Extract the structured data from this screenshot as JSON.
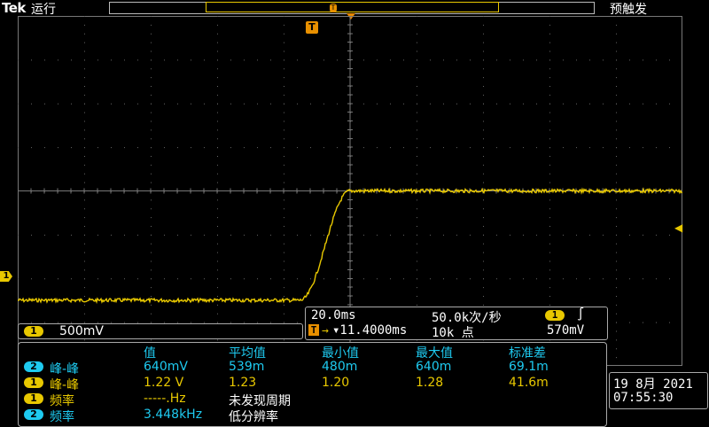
{
  "header": {
    "brand": "Tek",
    "run_status": "运行",
    "trigger_status": "预触发"
  },
  "markers": {
    "trigger_t": "T",
    "ch1_marker": "1",
    "trigger_level_arrow": "◀"
  },
  "channel_scale": {
    "channel": "1",
    "scale": "500mV"
  },
  "timebase": {
    "time_per_div": "20.0ms",
    "sample_rate": "50.0k次/秒",
    "trigger_channel": "1",
    "trigger_slope": "∫",
    "trigger_level": "570mV",
    "trigger_delay_label": "T",
    "trigger_delay": "▾11.4000ms",
    "record_length": "10k 点"
  },
  "measurements": {
    "headers": [
      "值",
      "平均值",
      "最小值",
      "最大值",
      "标准差"
    ],
    "rows": [
      {
        "channel": "2",
        "name": "峰-峰",
        "value": "640mV",
        "mean": "539m",
        "min": "480m",
        "max": "640m",
        "std": "69.1m"
      },
      {
        "channel": "1",
        "name": "峰-峰",
        "value": "1.22 V",
        "mean": "1.23",
        "min": "1.20",
        "max": "1.28",
        "std": "41.6m"
      },
      {
        "channel": "1",
        "name": "频率",
        "value": "-----.Hz",
        "note": "未发现周期"
      },
      {
        "channel": "2",
        "name": "频率",
        "value": "3.448kHz",
        "note": "低分辨率"
      }
    ]
  },
  "datetime": {
    "date": "19 8月  2021",
    "time": "07:55:30"
  },
  "colors": {
    "ch1": "#e8c800",
    "ch2": "#1ecaf0",
    "trigger": "#e89000"
  },
  "waveform": {
    "channel": "1",
    "low_level_div": 2.5,
    "high_level_div": 0.0,
    "rise_start_div": -0.75,
    "rise_end_div": 0.0
  }
}
